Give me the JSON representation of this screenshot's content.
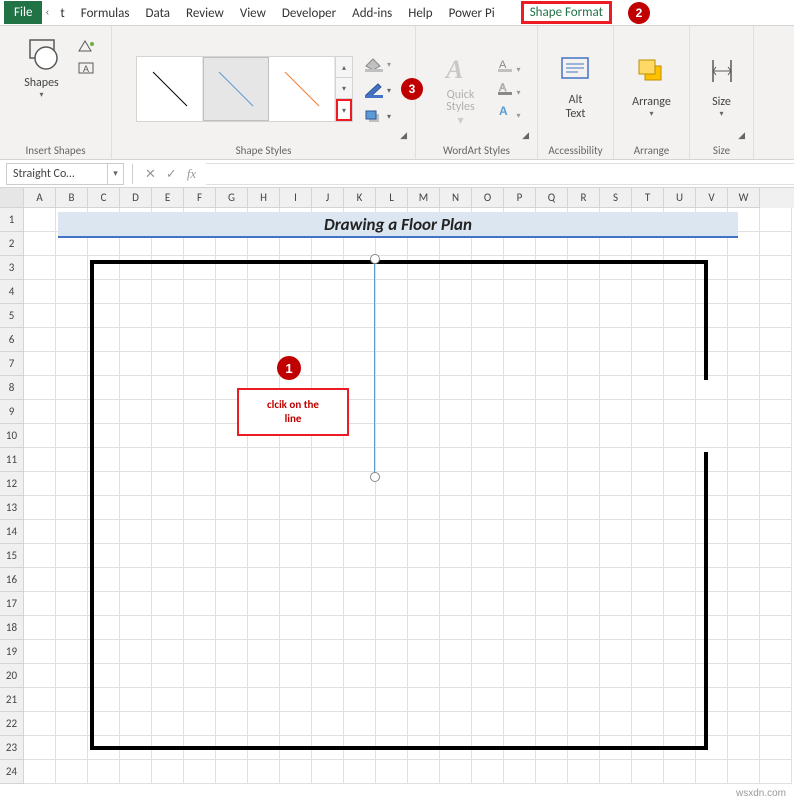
{
  "tabs": {
    "file": "File",
    "cut": "t",
    "formulas": "Formulas",
    "data": "Data",
    "review": "Review",
    "view": "View",
    "developer": "Developer",
    "addins": "Add-ins",
    "help": "Help",
    "powerpi": "Power Pi",
    "shape_format": "Shape Format"
  },
  "ribbon": {
    "insert_shapes": {
      "label": "Insert Shapes",
      "shapes_btn": "Shapes"
    },
    "shape_styles": {
      "label": "Shape Styles"
    },
    "wordart": {
      "label": "WordArt Styles",
      "quick": "Quick\nStyles"
    },
    "accessibility": {
      "label": "Accessibility",
      "alt": "Alt\nText"
    },
    "arrange": {
      "label": "Arrange",
      "arrange_btn": "Arrange"
    },
    "size": {
      "label": "Size",
      "size_btn": "Size"
    }
  },
  "name_box": "Straight Co…",
  "fx": "fx",
  "columns": [
    "A",
    "B",
    "C",
    "D",
    "E",
    "F",
    "G",
    "H",
    "I",
    "J",
    "K",
    "L",
    "M",
    "N",
    "O",
    "P",
    "Q",
    "R",
    "S",
    "T",
    "U",
    "V",
    "W"
  ],
  "rows": [
    "1",
    "2",
    "3",
    "4",
    "5",
    "6",
    "7",
    "8",
    "9",
    "10",
    "11",
    "12",
    "13",
    "14",
    "15",
    "16",
    "17",
    "18",
    "19",
    "20",
    "21",
    "22",
    "23",
    "24"
  ],
  "title": "Drawing a Floor Plan",
  "annotations": {
    "one": "1",
    "two": "2",
    "three": "3",
    "click_line": "clcik on the\nline"
  },
  "watermark": "wsxdn.com"
}
